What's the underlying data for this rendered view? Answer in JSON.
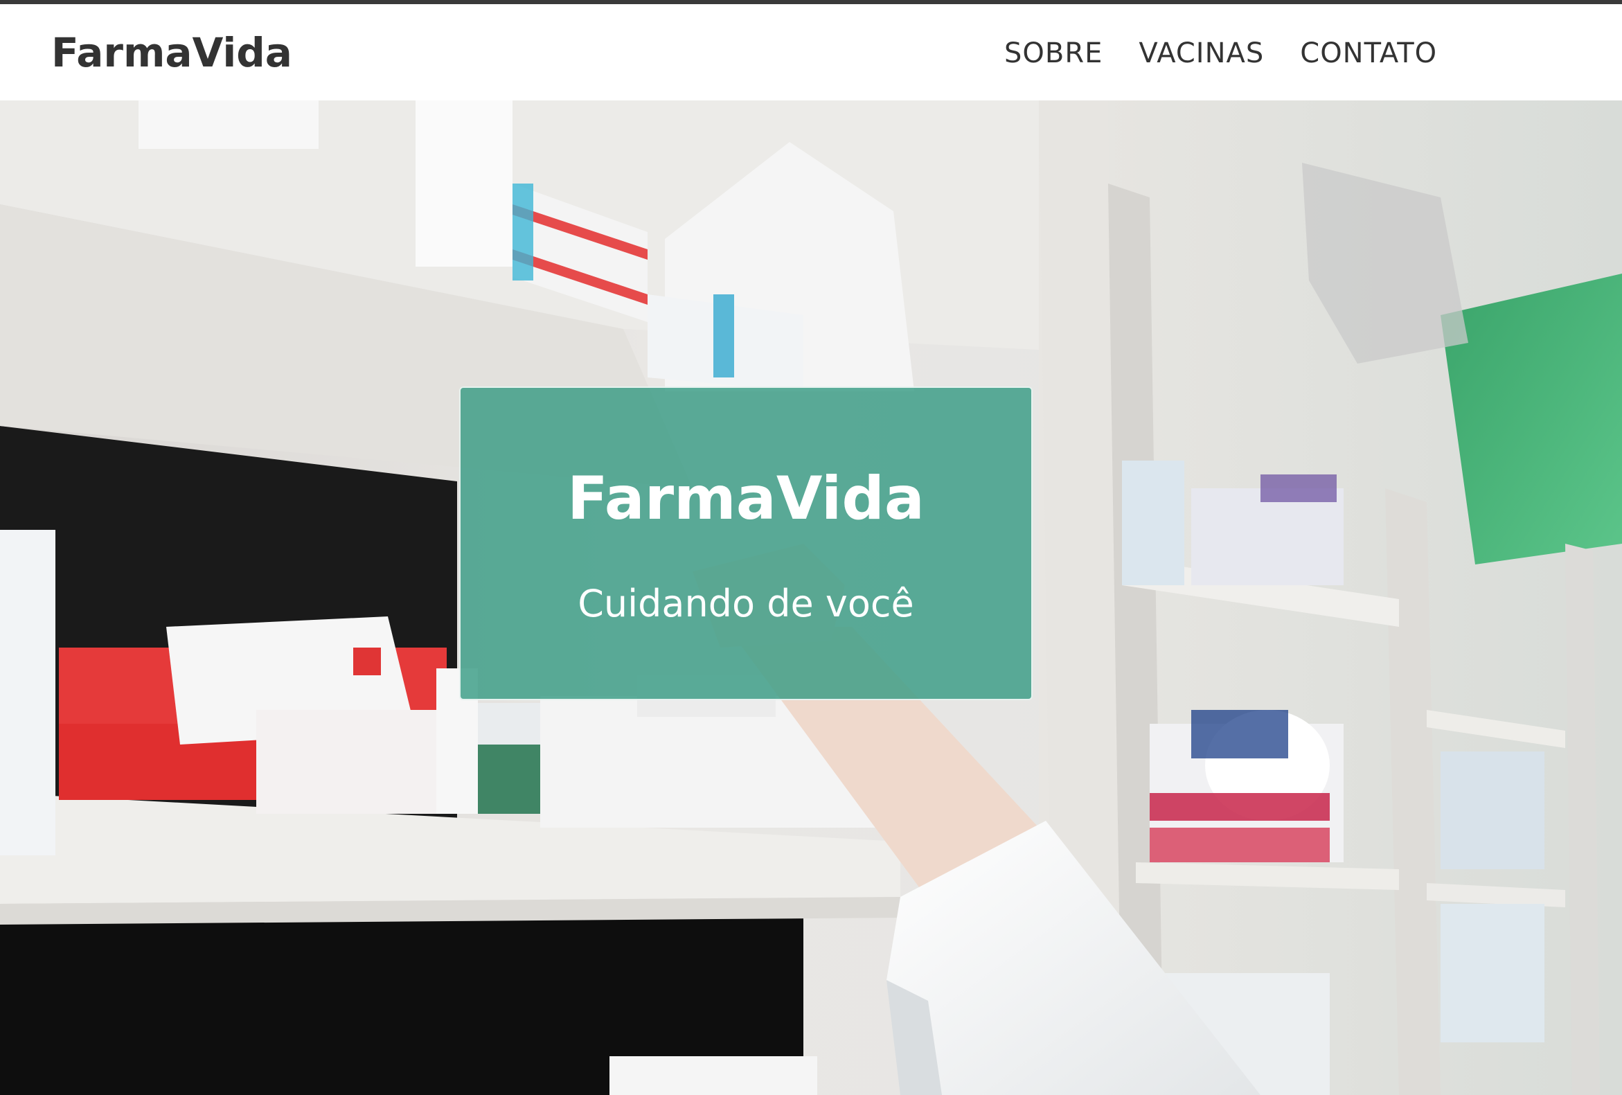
{
  "brand": "FarmaVida",
  "nav": {
    "items": [
      {
        "label": "SOBRE"
      },
      {
        "label": "VACINAS"
      },
      {
        "label": "CONTATO"
      }
    ]
  },
  "hero": {
    "title": "FarmaVida",
    "subtitle": "Cuidando de você",
    "image_subject": "pharmacy-shelves-photo"
  },
  "colors": {
    "card_green": "#349A82",
    "text_dark": "#333333"
  }
}
